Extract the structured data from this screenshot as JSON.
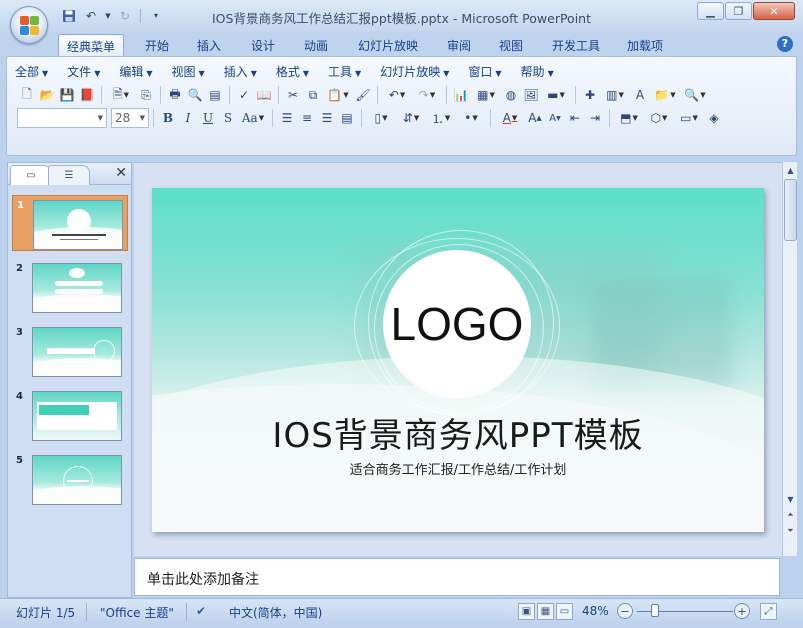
{
  "window": {
    "title": "IOS背景商务风工作总结汇报ppt模板.pptx - Microsoft PowerPoint"
  },
  "quick_access": {
    "save_icon": "save-icon",
    "undo_icon": "undo-icon",
    "redo_icon": "redo-icon",
    "customize_icon": "customize-icon"
  },
  "tabs": [
    "经典菜单",
    "开始",
    "插入",
    "设计",
    "动画",
    "幻灯片放映",
    "审阅",
    "视图",
    "开发工具",
    "加载项"
  ],
  "menu": [
    "全部",
    "文件",
    "编辑",
    "视图",
    "插入",
    "格式",
    "工具",
    "幻灯片放映",
    "窗口",
    "帮助"
  ],
  "format_bar": {
    "font_name": "",
    "font_size": "28",
    "bold": "B",
    "italic": "I",
    "underline": "U",
    "strikethrough": "S",
    "change_case": "Aa"
  },
  "slides": [
    {
      "number": "1"
    },
    {
      "number": "2"
    },
    {
      "number": "3"
    },
    {
      "number": "4"
    },
    {
      "number": "5"
    }
  ],
  "slide": {
    "logo": "LOGO",
    "title": "IOS背景商务风PPT模板",
    "subtitle": "适合商务工作汇报/工作总结/工作计划"
  },
  "notes": {
    "placeholder": "单击此处添加备注"
  },
  "status": {
    "slide_info": "幻灯片 1/5",
    "theme": "\"Office 主题\"",
    "language": "中文(简体，中国)",
    "zoom": "48%"
  },
  "colors": {
    "accent": "#e8a064",
    "slide_teal": "#5cdfc9"
  }
}
